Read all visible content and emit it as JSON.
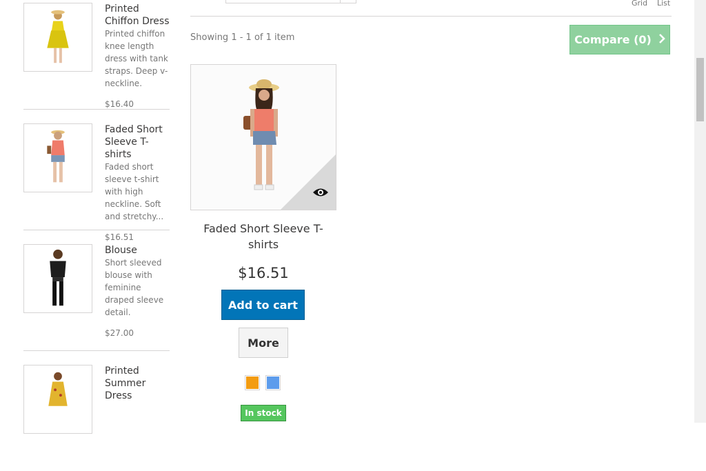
{
  "sidebar": {
    "items": [
      {
        "name": "Printed Chiffon Dress",
        "desc": "Printed chiffon knee length dress with tank straps. Deep v-neckline.",
        "price": "$16.40"
      },
      {
        "name": "Faded Short Sleeve T-shirts",
        "desc": "Faded short sleeve t-shirt with high neckline. Soft and stretchy...",
        "price": "$16.51"
      },
      {
        "name": "Blouse",
        "desc": "Short sleeved blouse with feminine draped sleeve detail.",
        "price": "$27.00"
      },
      {
        "name": "Printed Summer Dress",
        "desc": "",
        "price": ""
      }
    ]
  },
  "toolbar": {
    "view_grid": "Grid",
    "view_list": "List",
    "showing": "Showing 1 - 1 of 1 item",
    "compare_label": "Compare (0)"
  },
  "product": {
    "name": "Faded Short Sleeve T-shirts",
    "price": "$16.51",
    "add_to_cart": "Add to cart",
    "more": "More",
    "stock": "In stock",
    "colors": [
      "#f39c11",
      "#5d9cec"
    ]
  },
  "colors": {
    "compare_bg": "#8fd19e",
    "cart_bg": "#0275b8",
    "stock_bg": "#55c65e"
  },
  "icons": {
    "quickview": "eye-icon",
    "compare_chevron": "chevron-right-icon"
  }
}
